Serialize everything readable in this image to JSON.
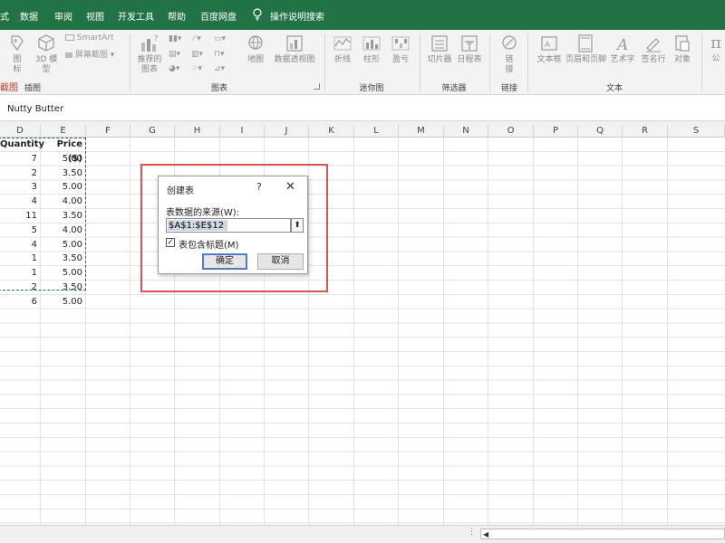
{
  "menu": {
    "tabs": [
      "式",
      "数据",
      "审阅",
      "视图",
      "开发工具",
      "帮助",
      "百度网盘"
    ],
    "tell_me": "操作说明搜索"
  },
  "ribbon": {
    "illustrations": {
      "pictures": "图\n标",
      "models": "3D 模\n型",
      "smartart": "SmartArt",
      "screenshot": "屏幕截图",
      "group_label": "插图",
      "cut_text": "截图"
    },
    "charts": {
      "recommended": "推荐的\n图表",
      "maps": "地图",
      "pivot_chart": "数据透视图",
      "group_label": "图表"
    },
    "sparklines": {
      "line": "折线",
      "column": "柱形",
      "win_loss": "盈亏",
      "group_label": "迷你图"
    },
    "filters": {
      "slicer": "切片器",
      "timeline": "日程表",
      "group_label": "筛选器"
    },
    "links": {
      "link": "链\n接",
      "group_label": "链接"
    },
    "text": {
      "textbox": "文本框",
      "header_footer": "页眉和页脚",
      "wordart": "艺术字",
      "signature": "签名行",
      "object": "对象",
      "group_label": "文本"
    },
    "symbols": {
      "equation": "公"
    }
  },
  "formula_bar": {
    "value": "Nutty Butter"
  },
  "columns": [
    "D",
    "E",
    "F",
    "G",
    "H",
    "I",
    "J",
    "K",
    "L",
    "M",
    "N",
    "O",
    "P",
    "Q",
    "R",
    "S"
  ],
  "table": {
    "headers": [
      "Quantity",
      "Price ($)"
    ],
    "rows": [
      [
        "7",
        "5.00"
      ],
      [
        "2",
        "3.50"
      ],
      [
        "3",
        "5.00"
      ],
      [
        "4",
        "4.00"
      ],
      [
        "11",
        "3.50"
      ],
      [
        "5",
        "4.00"
      ],
      [
        "4",
        "5.00"
      ],
      [
        "1",
        "3.50"
      ],
      [
        "1",
        "5.00"
      ],
      [
        "2",
        "3.50"
      ],
      [
        "6",
        "5.00"
      ]
    ]
  },
  "dialog": {
    "title": "创建表",
    "help": "?",
    "close": "✕",
    "source_label": "表数据的来源(W):",
    "source_value": "$A$1:$E$12",
    "has_headers_label": "表包含标题(M)",
    "has_headers_checked": true,
    "ok_label": "确定",
    "cancel_label": "取消"
  },
  "colors": {
    "accent": "#217346",
    "highlight": "#d9534f"
  }
}
